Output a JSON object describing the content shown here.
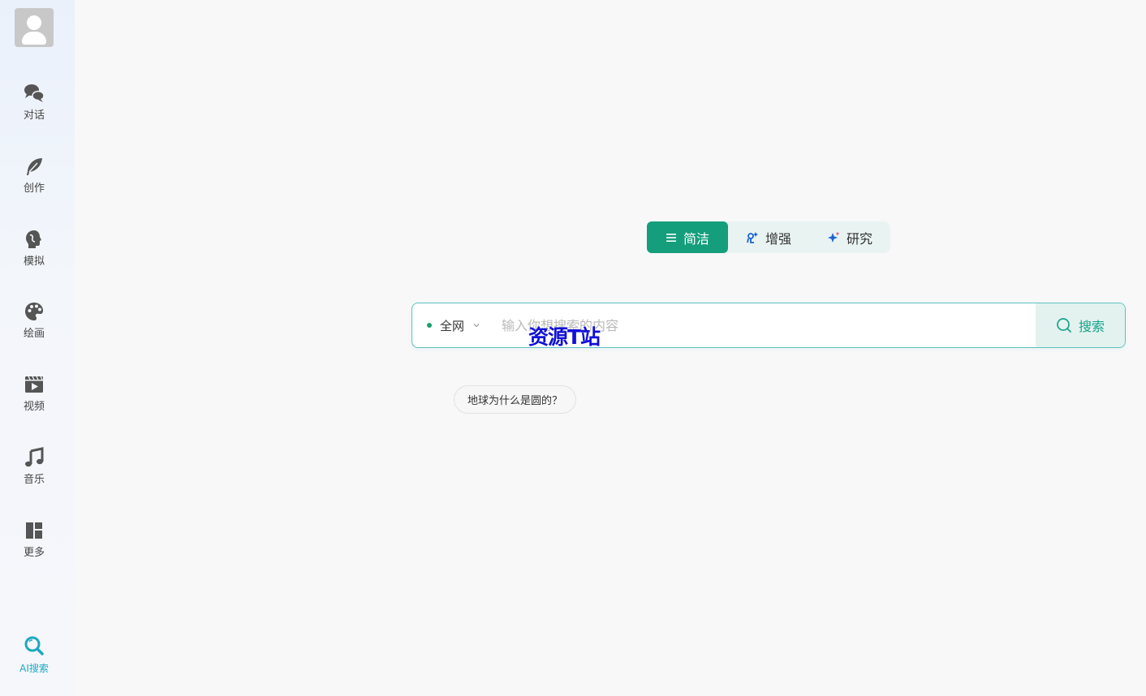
{
  "sidebar": {
    "items": [
      {
        "label": "对话",
        "icon": "chat-bubbles-icon"
      },
      {
        "label": "创作",
        "icon": "feather-icon"
      },
      {
        "label": "模拟",
        "icon": "head-profile-icon"
      },
      {
        "label": "绘画",
        "icon": "palette-icon"
      },
      {
        "label": "视频",
        "icon": "video-clapper-icon"
      },
      {
        "label": "音乐",
        "icon": "music-note-icon"
      },
      {
        "label": "更多",
        "icon": "grid-layout-icon"
      }
    ],
    "active_item": {
      "label": "AI搜索",
      "icon": "search-icon"
    }
  },
  "modes": {
    "tabs": [
      {
        "label": "简洁",
        "icon": "list-icon",
        "selected": true
      },
      {
        "label": "增强",
        "icon": "enhance-icon",
        "selected": false
      },
      {
        "label": "研究",
        "icon": "sparkle-icon",
        "selected": false
      }
    ]
  },
  "search": {
    "scope_label": "全网",
    "placeholder": "输入你想搜索的内容",
    "value": "",
    "button_label": "搜索"
  },
  "watermark": "资源T站",
  "suggestions": [
    "地球为什么是圆的？"
  ],
  "colors": {
    "accent": "#149e7c",
    "active_nav": "#1ea8c1",
    "search_border": "#5cc1c0"
  }
}
